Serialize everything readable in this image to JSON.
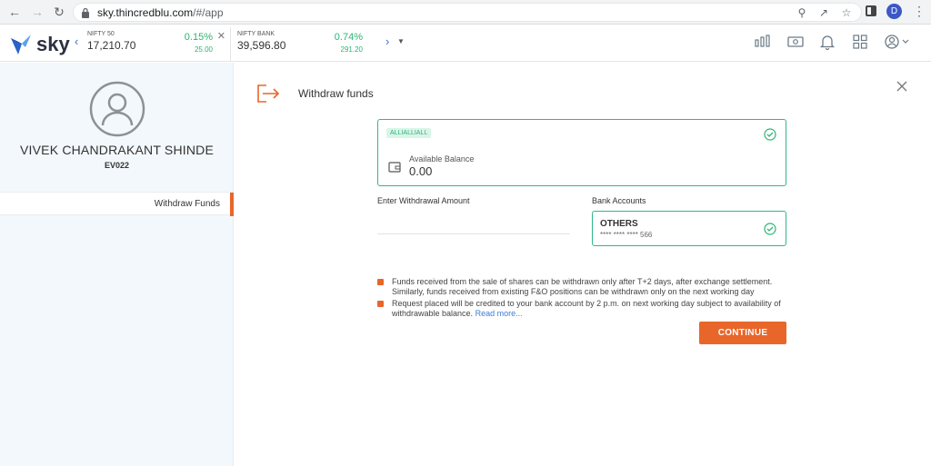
{
  "browser": {
    "url_host": "sky.thincredblu.com",
    "url_path": "/#/app",
    "profile_initial": "D"
  },
  "app": {
    "brand": "sky"
  },
  "tickers": [
    {
      "name": "NIFTY 50",
      "value": "17,210.70",
      "pct": "0.15%",
      "change": "25.00"
    },
    {
      "name": "NIFTY BANK",
      "value": "39,596.80",
      "pct": "0.74%",
      "change": "291.20"
    }
  ],
  "user": {
    "name": "VIVEK CHANDRAKANT SHINDE",
    "code": "EV022"
  },
  "sidebar": {
    "items": [
      {
        "label": "Withdraw Funds",
        "active": true
      }
    ]
  },
  "main": {
    "title": "Withdraw funds",
    "account": {
      "tag": "ALLIALLIALL",
      "balance_label": "Available Balance",
      "balance_value": "0.00"
    },
    "amount": {
      "label": "Enter Withdrawal Amount",
      "value": "",
      "placeholder": ""
    },
    "bank": {
      "label": "Bank Accounts",
      "name": "OTHERS",
      "number": "**** **** **** 566"
    },
    "notes": [
      {
        "text": "Funds received from the sale of shares can be withdrawn only after T+2 days, after exchange settlement. Similarly, funds received from existing F&O positions can be withdrawn only on the next working day",
        "link": ""
      },
      {
        "text": "Request placed will be credited to your bank account by 2 p.m. on next working day subject to availability of withdrawable balance.",
        "link": "Read more..."
      }
    ],
    "continue_label": "CONTINUE"
  },
  "colors": {
    "accent": "#e8662a",
    "success": "#2bb673",
    "panel_bg": "#f2f8fb"
  }
}
